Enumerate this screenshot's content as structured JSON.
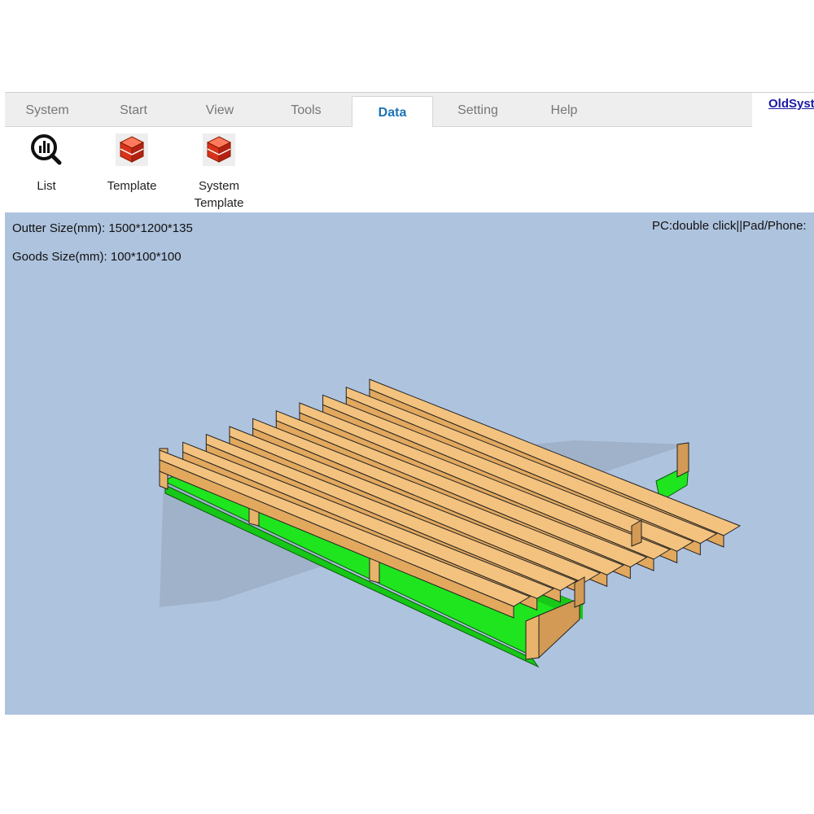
{
  "tabs": [
    {
      "label": "System"
    },
    {
      "label": "Start"
    },
    {
      "label": "View"
    },
    {
      "label": "Tools"
    },
    {
      "label": "Data"
    },
    {
      "label": "Setting"
    },
    {
      "label": "Help"
    }
  ],
  "active_tab": "Data",
  "header_link": "OldSyst",
  "ribbon": {
    "list_label": "List",
    "template_label": "Template",
    "system_template_label": "System\nTemplate"
  },
  "info": {
    "outter_size": "Outter Size(mm): 1500*1200*135",
    "goods_size": "Goods Size(mm): 100*100*100",
    "hint": "PC:double click||Pad/Phone:"
  },
  "colors": {
    "accent": "#1a73b8",
    "viewport_bg": "#aec3de",
    "wood": "#f3c27e",
    "base": "#22ee22"
  }
}
